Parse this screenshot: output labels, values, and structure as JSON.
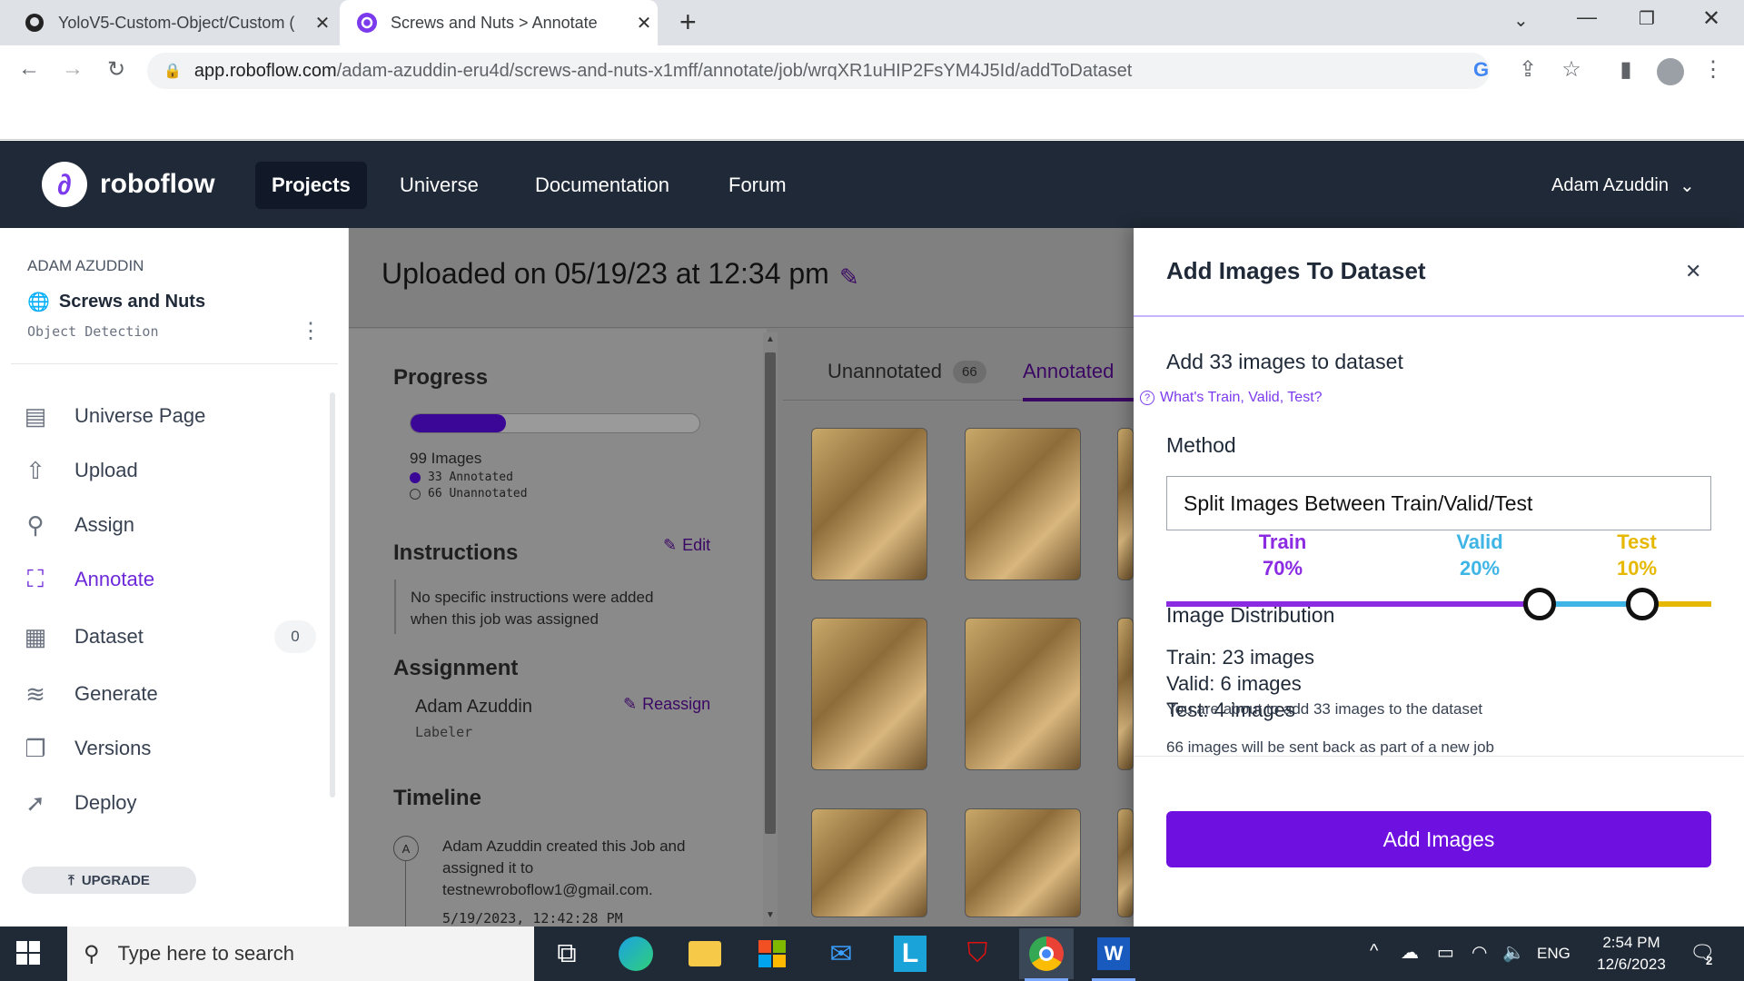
{
  "browser": {
    "tabs": [
      {
        "title": "YoloV5-Custom-Object/Custom (",
        "icon": "github-icon"
      },
      {
        "title": "Screws and Nuts > Annotate",
        "icon": "roboflow-icon"
      }
    ],
    "url_host": "app.roboflow.com",
    "url_path": "/adam-azuddin-eru4d/screws-and-nuts-x1mff/annotate/job/wrqXR1uHIP2FsYM4J5Id/addToDataset"
  },
  "app": {
    "brand": "roboflow",
    "nav": [
      "Projects",
      "Universe",
      "Documentation",
      "Forum"
    ],
    "user": "Adam Azuddin"
  },
  "sidebar": {
    "owner": "ADAM AZUDDIN",
    "project": "Screws and Nuts",
    "project_type": "Object Detection",
    "items": [
      {
        "label": "Universe Page",
        "icon": "universe-page-icon"
      },
      {
        "label": "Upload",
        "icon": "upload-icon"
      },
      {
        "label": "Assign",
        "icon": "search-icon"
      },
      {
        "label": "Annotate",
        "icon": "annotate-icon"
      },
      {
        "label": "Dataset",
        "icon": "dataset-icon",
        "badge": "0"
      },
      {
        "label": "Generate",
        "icon": "generate-icon"
      },
      {
        "label": "Versions",
        "icon": "versions-icon"
      },
      {
        "label": "Deploy",
        "icon": "rocket-icon"
      }
    ],
    "upgrade": "UPGRADE"
  },
  "job": {
    "title": "Uploaded on 05/19/23 at 12:34 pm",
    "progress_title": "Progress",
    "progress_fraction": 0.33,
    "images_total": "99 Images",
    "annotated": "33 Annotated",
    "unannotated": "66 Unannotated",
    "instructions_title": "Instructions",
    "edit": "Edit",
    "instructions_text": "No specific instructions were added when this job was assigned",
    "assignment_title": "Assignment",
    "assignee": "Adam Azuddin",
    "assignee_role": "Labeler",
    "reassign": "Reassign",
    "timeline_title": "Timeline",
    "timeline_avatar": "A",
    "timeline_text": "Adam Azuddin created this Job and assigned it to testnewroboflow1@gmail.com.",
    "timeline_time": "5/19/2023, 12:42:28 PM",
    "tabs": [
      {
        "label": "Unannotated",
        "count": "66"
      },
      {
        "label": "Annotated"
      }
    ]
  },
  "drawer": {
    "title": "Add Images To Dataset",
    "subtitle": "Add 33 images to dataset",
    "help_link": "What's Train, Valid, Test?",
    "method_label": "Method",
    "method_value": "Split Images Between Train/Valid/Test",
    "split": [
      {
        "name": "Train",
        "pct": "70%",
        "color": "#8b2be2"
      },
      {
        "name": "Valid",
        "pct": "20%",
        "color": "#3fb5e6"
      },
      {
        "name": "Test",
        "pct": "10%",
        "color": "#e6b800"
      }
    ],
    "distribution_title": "Image Distribution",
    "train_count": "Train: 23 images",
    "valid_count": "Valid: 6 images",
    "test_count": "Test: 4 images",
    "overlay_note": "You are about to add 33 images to the dataset",
    "note2": "66 images will be sent back as part of a new job",
    "button": "Add Images"
  },
  "taskbar": {
    "search_placeholder": "Type here to search",
    "lang": "ENG",
    "time": "2:54 PM",
    "date": "12/6/2023",
    "notif_count": "2"
  }
}
